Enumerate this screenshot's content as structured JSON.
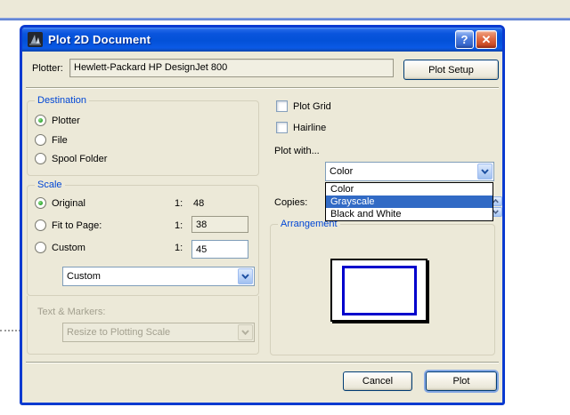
{
  "dialog": {
    "title": "Plot 2D Document",
    "titlebar_icons": {
      "help": "?",
      "close": "✕"
    },
    "plotter": {
      "label": "Plotter:",
      "value": "Hewlett-Packard HP DesignJet 800",
      "setup_button": "Plot Setup"
    },
    "destination": {
      "title": "Destination",
      "options": [
        {
          "label": "Plotter",
          "selected": true
        },
        {
          "label": "File",
          "selected": false
        },
        {
          "label": "Spool Folder",
          "selected": false
        }
      ]
    },
    "scale": {
      "title": "Scale",
      "rows": [
        {
          "label": "Original",
          "ratio": "1:",
          "value": "48",
          "selected": true
        },
        {
          "label": "Fit to Page:",
          "ratio": "1:",
          "value": "38",
          "selected": false
        },
        {
          "label": "Custom",
          "ratio": "1:",
          "value": "45",
          "selected": false
        }
      ],
      "preset_value": "Custom"
    },
    "text_markers": {
      "label": "Text & Markers:",
      "value": "Resize to Plotting Scale",
      "disabled": true
    },
    "options": {
      "plot_grid_label": "Plot Grid",
      "plot_grid_checked": false,
      "hairline_label": "Hairline",
      "hairline_checked": false,
      "plot_with_label": "Plot with...",
      "plot_with_value": "Color"
    },
    "plot_with_list": {
      "items": [
        "Color",
        "Grayscale",
        "Black and White"
      ],
      "highlighted": "Grayscale"
    },
    "copies_label": "Copies:",
    "arrangement_title": "Arrangement",
    "footer": {
      "cancel": "Cancel",
      "plot": "Plot"
    }
  },
  "colors": {
    "titlebar_blue": "#0353d8",
    "dialog_bg": "#ece9d8",
    "dialog_border": "#0a3ad0",
    "group_title_blue": "#0046d5",
    "selection_blue": "#316ac5",
    "preview_rect_blue": "#0000cc",
    "close_button_red": "#d5502c",
    "radio_green": "#2ba22a"
  }
}
